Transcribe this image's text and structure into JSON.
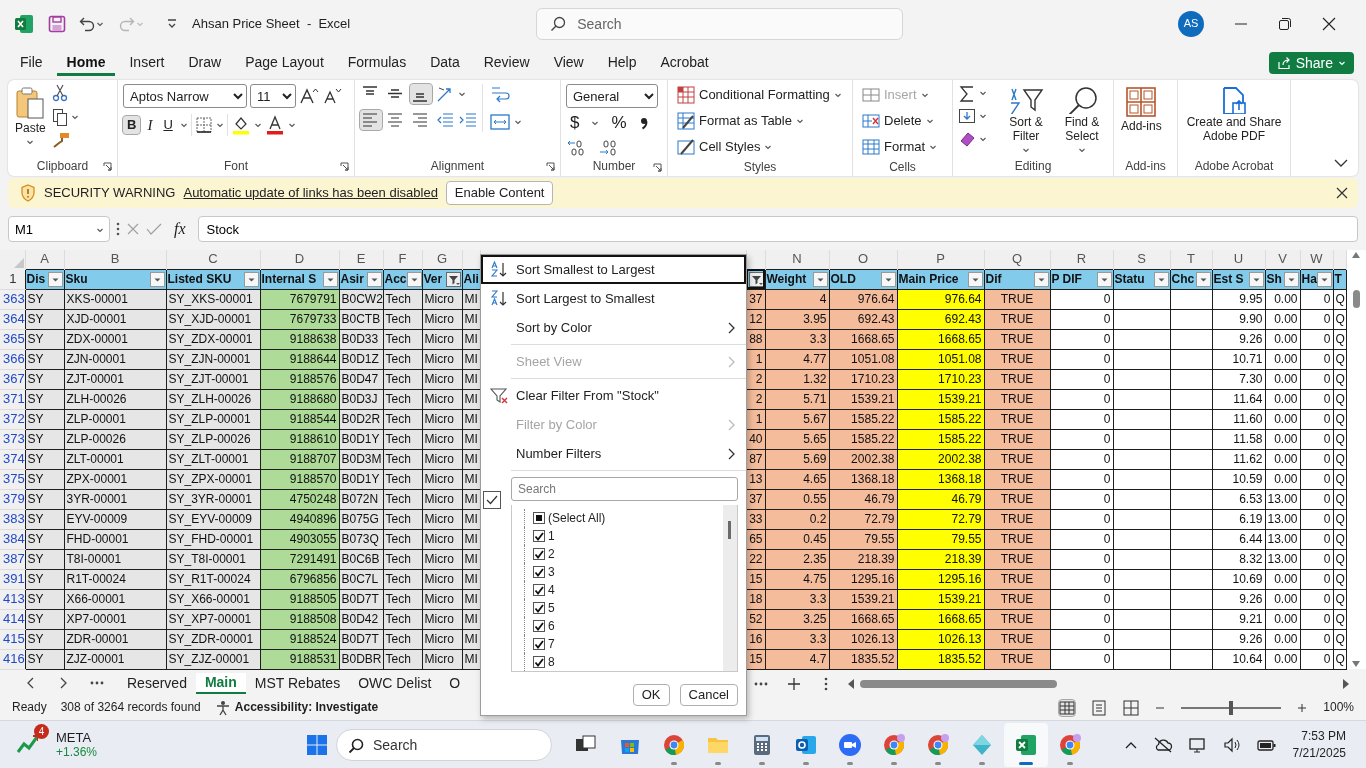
{
  "window": {
    "title": "Ahsan Price Sheet  -  Excel",
    "search_placeholder": "Search",
    "account_initials": "AS"
  },
  "menu_tabs": [
    {
      "label": "File",
      "selected": false
    },
    {
      "label": "Home",
      "selected": true
    },
    {
      "label": "Insert",
      "selected": false
    },
    {
      "label": "Draw",
      "selected": false
    },
    {
      "label": "Page Layout",
      "selected": false
    },
    {
      "label": "Formulas",
      "selected": false
    },
    {
      "label": "Data",
      "selected": false
    },
    {
      "label": "Review",
      "selected": false
    },
    {
      "label": "View",
      "selected": false
    },
    {
      "label": "Help",
      "selected": false
    },
    {
      "label": "Acrobat",
      "selected": false
    }
  ],
  "share_button": "Share",
  "ribbon": {
    "clipboard": {
      "label": "Clipboard",
      "paste": "Paste"
    },
    "font": {
      "label": "Font",
      "font_name": "Aptos Narrow",
      "font_size": "11",
      "style_buttons": [
        {
          "label": "B",
          "selected": true
        },
        {
          "label": "I",
          "selected": false
        },
        {
          "label": "U",
          "selected": false
        }
      ]
    },
    "alignment": {
      "label": "Alignment",
      "vertical": [
        {
          "selected": false
        },
        {
          "selected": false
        },
        {
          "selected": true
        }
      ],
      "horizontal": [
        {
          "selected": true
        },
        {
          "selected": false
        },
        {
          "selected": false
        }
      ]
    },
    "number": {
      "label": "Number",
      "format": "General",
      "symbols": [
        "$",
        "%"
      ]
    },
    "styles": {
      "label": "Styles",
      "commands": [
        "Conditional Formatting",
        "Format as Table",
        "Cell Styles"
      ]
    },
    "cells": {
      "label": "Cells",
      "commands": [
        {
          "label": "Insert",
          "disabled": true
        },
        {
          "label": "Delete",
          "disabled": false
        },
        {
          "label": "Format",
          "disabled": false
        }
      ]
    },
    "editing": {
      "label": "Editing",
      "commands": [
        "Sort & Filter",
        "Find & Select"
      ]
    },
    "addins": {
      "label": "Add-ins",
      "command": "Add-ins"
    },
    "acrobat": {
      "label": "Adobe Acrobat",
      "command": "Create and Share Adobe PDF"
    }
  },
  "security_bar": {
    "title": "SECURITY WARNING",
    "message": "Automatic update of links has been disabled",
    "button": "Enable Content"
  },
  "formula_bar": {
    "name_box": "M1",
    "insert_function": "fx",
    "formula": "Stock"
  },
  "sheet": {
    "header_row": "1",
    "columns": [
      {
        "letter": "A",
        "header": "Dis",
        "kind": "text",
        "color": "#e6e6e6",
        "filter_button": true,
        "filtered": false,
        "selected": false
      },
      {
        "letter": "B",
        "header": "Sku",
        "kind": "text",
        "color": "#e6e6e6",
        "filter_button": true,
        "filtered": false,
        "selected": false
      },
      {
        "letter": "C",
        "header": "Listed SKU",
        "kind": "text",
        "color": "#e6e6e6",
        "filter_button": true,
        "filtered": false,
        "selected": false
      },
      {
        "letter": "D",
        "header": "Internal S",
        "kind": "number",
        "color": "#aedc98",
        "filter_button": true,
        "filtered": false,
        "selected": false
      },
      {
        "letter": "E",
        "header": "Asir",
        "kind": "text",
        "color": "#e6e6e6",
        "filter_button": true,
        "filtered": false,
        "selected": false
      },
      {
        "letter": "F",
        "header": "Acc",
        "kind": "text",
        "color": "#e6e6e6",
        "filter_button": true,
        "filtered": false,
        "selected": false
      },
      {
        "letter": "G",
        "header": "Ver",
        "kind": "text",
        "color": "#e6e6e6",
        "filter_button": true,
        "filtered": true,
        "selected": false
      },
      {
        "header": "Ali",
        "kind": "text",
        "color": "#e6e6e6",
        "selected": false
      },
      {
        "kind": "number",
        "color": "#f5bc9c",
        "filter_button": true,
        "filtered": true,
        "selected": true
      },
      {
        "letter": "N",
        "header": "Weight",
        "kind": "number",
        "color": "#f5bc9c",
        "filter_button": true,
        "filtered": false,
        "selected": false
      },
      {
        "letter": "O",
        "header": "OLD",
        "kind": "number",
        "color": "#f5bc9c",
        "filter_button": true,
        "filtered": false,
        "selected": false
      },
      {
        "letter": "P",
        "header": "Main Price",
        "kind": "number",
        "color": "#ffff00",
        "filter_button": true,
        "filtered": false,
        "selected": false
      },
      {
        "letter": "Q",
        "header": "Dif",
        "kind": "boolean",
        "color": "#f5bc9c",
        "filter_button": true,
        "filtered": false,
        "selected": false
      },
      {
        "letter": "R",
        "header": "P DIF",
        "kind": "number",
        "color": "#ffffff",
        "filter_button": true,
        "filtered": false,
        "selected": false
      },
      {
        "letter": "S",
        "header": "Statu",
        "color": "#ffffff",
        "filter_button": true,
        "filtered": false,
        "selected": false
      },
      {
        "letter": "T",
        "header": "Chc",
        "color": "#ffffff",
        "filter_button": true,
        "filtered": false,
        "selected": false
      },
      {
        "letter": "U",
        "header": "Est S",
        "kind": "number",
        "color": "#ffffff",
        "filter_button": true,
        "filtered": false,
        "selected": false
      },
      {
        "letter": "V",
        "header": "Sh",
        "kind": "number",
        "color": "#ffffff",
        "filter_button": true,
        "filtered": false,
        "selected": false
      },
      {
        "letter": "W",
        "header": "Ha",
        "kind": "number",
        "color": "#ffffff",
        "filter_button": true,
        "filtered": false,
        "selected": false
      },
      {
        "header": "T",
        "kind": "text",
        "color": "#ffffff",
        "selected": false
      }
    ],
    "rows": [
      {
        "row": "363",
        "cells": [
          "SY",
          "XKS-00001",
          "SY_XKS-00001",
          "7679791",
          "B0CW2",
          "Tech",
          "Micro",
          "MI",
          "37",
          "4",
          "976.64",
          "976.64",
          "TRUE",
          "0",
          null,
          null,
          "9.95",
          "0.00",
          "0",
          "Q"
        ]
      },
      {
        "row": "364",
        "cells": [
          "SY",
          "XJD-00001",
          "SY_XJD-00001",
          "7679733",
          "B0CTB",
          "Tech",
          "Micro",
          "MI",
          "12",
          "3.95",
          "692.43",
          "692.43",
          "TRUE",
          "0",
          null,
          null,
          "9.90",
          "0.00",
          "0",
          "Q"
        ]
      },
      {
        "row": "365",
        "cells": [
          "SY",
          "ZDX-00001",
          "SY_ZDX-00001",
          "9188638",
          "B0D33",
          "Tech",
          "Micro",
          "MI",
          "88",
          "3.3",
          "1668.65",
          "1668.65",
          "TRUE",
          "0",
          null,
          null,
          "9.26",
          "0.00",
          "0",
          "Q"
        ]
      },
      {
        "row": "366",
        "cells": [
          "SY",
          "ZJN-00001",
          "SY_ZJN-00001",
          "9188644",
          "B0D1Z",
          "Tech",
          "Micro",
          "MI",
          "1",
          "4.77",
          "1051.08",
          "1051.08",
          "TRUE",
          "0",
          null,
          null,
          "10.71",
          "0.00",
          "0",
          "Q"
        ]
      },
      {
        "row": "367",
        "cells": [
          "SY",
          "ZJT-00001",
          "SY_ZJT-00001",
          "9188576",
          "B0D47",
          "Tech",
          "Micro",
          "MI",
          "2",
          "1.32",
          "1710.23",
          "1710.23",
          "TRUE",
          "0",
          null,
          null,
          "7.30",
          "0.00",
          "0",
          "Q"
        ]
      },
      {
        "row": "371",
        "cells": [
          "SY",
          "ZLH-00026",
          "SY_ZLH-00026",
          "9188680",
          "B0D3J",
          "Tech",
          "Micro",
          "MI",
          "2",
          "5.71",
          "1539.21",
          "1539.21",
          "TRUE",
          "0",
          null,
          null,
          "11.64",
          "0.00",
          "0",
          "Q"
        ]
      },
      {
        "row": "372",
        "cells": [
          "SY",
          "ZLP-00001",
          "SY_ZLP-00001",
          "9188544",
          "B0D2R",
          "Tech",
          "Micro",
          "MI",
          "1",
          "5.67",
          "1585.22",
          "1585.22",
          "TRUE",
          "0",
          null,
          null,
          "11.60",
          "0.00",
          "0",
          "Q"
        ]
      },
      {
        "row": "373",
        "cells": [
          "SY",
          "ZLP-00026",
          "SY_ZLP-00026",
          "9188610",
          "B0D1Y",
          "Tech",
          "Micro",
          "MI",
          "40",
          "5.65",
          "1585.22",
          "1585.22",
          "TRUE",
          "0",
          null,
          null,
          "11.58",
          "0.00",
          "0",
          "Q"
        ]
      },
      {
        "row": "374",
        "cells": [
          "SY",
          "ZLT-00001",
          "SY_ZLT-00001",
          "9188707",
          "B0D3M",
          "Tech",
          "Micro",
          "MI",
          "87",
          "5.69",
          "2002.38",
          "2002.38",
          "TRUE",
          "0",
          null,
          null,
          "11.62",
          "0.00",
          "0",
          "Q"
        ]
      },
      {
        "row": "375",
        "cells": [
          "SY",
          "ZPX-00001",
          "SY_ZPX-00001",
          "9188570",
          "B0D1Y",
          "Tech",
          "Micro",
          "MI",
          "13",
          "4.65",
          "1368.18",
          "1368.18",
          "TRUE",
          "0",
          null,
          null,
          "10.59",
          "0.00",
          "0",
          "Q"
        ]
      },
      {
        "row": "379",
        "cells": [
          "SY",
          "3YR-00001",
          "SY_3YR-00001",
          "4750248",
          "B072N",
          "Tech",
          "Micro",
          "MI",
          "37",
          "0.55",
          "46.79",
          "46.79",
          "TRUE",
          "0",
          null,
          null,
          "6.53",
          "13.00",
          "0",
          "Q"
        ]
      },
      {
        "row": "383",
        "cells": [
          "SY",
          "EYV-00009",
          "SY_EYV-00009",
          "4940896",
          "B075G",
          "Tech",
          "Micro",
          "MI",
          "33",
          "0.2",
          "72.79",
          "72.79",
          "TRUE",
          "0",
          null,
          null,
          "6.19",
          "13.00",
          "0",
          "Q"
        ]
      },
      {
        "row": "384",
        "cells": [
          "SY",
          "FHD-00001",
          "SY_FHD-00001",
          "4903055",
          "B073Q",
          "Tech",
          "Micro",
          "MI",
          "65",
          "0.45",
          "79.55",
          "79.55",
          "TRUE",
          "0",
          null,
          null,
          "6.44",
          "13.00",
          "0",
          "Q"
        ]
      },
      {
        "row": "387",
        "cells": [
          "SY",
          "T8I-00001",
          "SY_T8I-00001",
          "7291491",
          "B0C6B",
          "Tech",
          "Micro",
          "MI",
          "22",
          "2.35",
          "218.39",
          "218.39",
          "TRUE",
          "0",
          null,
          null,
          "8.32",
          "13.00",
          "0",
          "Q"
        ]
      },
      {
        "row": "391",
        "cells": [
          "SY",
          "R1T-00024",
          "SY_R1T-00024",
          "6796856",
          "B0C7L",
          "Tech",
          "Micro",
          "MI",
          "15",
          "4.75",
          "1295.16",
          "1295.16",
          "TRUE",
          "0",
          null,
          null,
          "10.69",
          "0.00",
          "0",
          "Q"
        ]
      },
      {
        "row": "413",
        "cells": [
          "SY",
          "X66-00001",
          "SY_X66-00001",
          "9188505",
          "B0D7T",
          "Tech",
          "Micro",
          "MI",
          "18",
          "3.3",
          "1539.21",
          "1539.21",
          "TRUE",
          "0",
          null,
          null,
          "9.26",
          "0.00",
          "0",
          "Q"
        ]
      },
      {
        "row": "414",
        "cells": [
          "SY",
          "XP7-00001",
          "SY_XP7-00001",
          "9188508",
          "B0D42",
          "Tech",
          "Micro",
          "MI",
          "52",
          "3.25",
          "1668.65",
          "1668.65",
          "TRUE",
          "0",
          null,
          null,
          "9.21",
          "0.00",
          "0",
          "Q"
        ]
      },
      {
        "row": "415",
        "cells": [
          "SY",
          "ZDR-00001",
          "SY_ZDR-00001",
          "9188524",
          "B0D7T",
          "Tech",
          "Micro",
          "MI",
          "16",
          "3.3",
          "1026.13",
          "1026.13",
          "TRUE",
          "0",
          null,
          null,
          "9.26",
          "0.00",
          "0",
          "Q"
        ]
      },
      {
        "row": "416",
        "cells": [
          "SY",
          "ZJZ-00001",
          "SY_ZJZ-00001",
          "9188531",
          "B0DBR",
          "Tech",
          "Micro",
          "MI",
          "15",
          "4.7",
          "1835.52",
          "1835.52",
          "TRUE",
          "0",
          null,
          null,
          "10.64",
          "0.00",
          "0",
          "Q"
        ]
      }
    ]
  },
  "filter_menu": {
    "sections": [
      [
        {
          "label": "Sort Smallest to Largest",
          "kind": "sort_ascending",
          "disabled": false,
          "submenu": false,
          "focused": true
        },
        {
          "label": "Sort Largest to Smallest",
          "kind": "sort_descending",
          "disabled": false,
          "submenu": false,
          "focused": false
        },
        {
          "label": "Sort by Color",
          "kind": "plain",
          "disabled": false,
          "submenu": true,
          "focused": false
        }
      ],
      [
        {
          "label": "Sheet View",
          "kind": "plain",
          "disabled": true,
          "submenu": true,
          "focused": false
        }
      ],
      [
        {
          "label": "Clear Filter From \"Stock\"",
          "kind": "clear_filter",
          "disabled": false,
          "submenu": false,
          "focused": false
        },
        {
          "label": "Filter by Color",
          "kind": "plain",
          "disabled": true,
          "submenu": true,
          "focused": false
        },
        {
          "label": "Number Filters",
          "kind": "plain",
          "disabled": false,
          "submenu": true,
          "focused": false
        }
      ]
    ],
    "search_placeholder": "Search",
    "side_checkbox": {
      "checked": true
    },
    "values": [
      {
        "label": "(Select All)",
        "checked": false,
        "mixed": true
      },
      {
        "label": "1",
        "checked": true,
        "mixed": false
      },
      {
        "label": "2",
        "checked": true,
        "mixed": false
      },
      {
        "label": "3",
        "checked": true,
        "mixed": false
      },
      {
        "label": "4",
        "checked": true,
        "mixed": false
      },
      {
        "label": "5",
        "checked": true,
        "mixed": false
      },
      {
        "label": "6",
        "checked": true,
        "mixed": false
      },
      {
        "label": "7",
        "checked": true,
        "mixed": false
      },
      {
        "label": "8",
        "checked": true,
        "mixed": false
      }
    ],
    "ok": "OK",
    "cancel": "Cancel"
  },
  "sheet_tabs": [
    {
      "label": "Reserved",
      "selected": false
    },
    {
      "label": "Main",
      "selected": true
    },
    {
      "label": "MST Rebates",
      "selected": false
    },
    {
      "label": "OWC Delist",
      "selected": false
    },
    {
      "label": "O",
      "selected": false
    }
  ],
  "status_bar": {
    "mode": "Ready",
    "records": "308 of 3264 records found",
    "accessibility": "Accessibility: Investigate",
    "views": [
      {
        "selected": true
      },
      {
        "selected": false
      },
      {
        "selected": false
      }
    ],
    "zoom": {
      "level": 0.5,
      "label": "100%"
    }
  },
  "taskbar": {
    "widget": {
      "title": "META",
      "change": "+1.36%",
      "badge": "4"
    },
    "search_placeholder": "Search",
    "apps": [
      {
        "kind": "taskview",
        "running": false,
        "active": false
      },
      {
        "kind": "store",
        "running": false,
        "active": false
      },
      {
        "kind": "browser",
        "running": true,
        "active": false
      },
      {
        "kind": "folder",
        "running": true,
        "active": false
      },
      {
        "kind": "calculator",
        "running": true,
        "active": false
      },
      {
        "kind": "mail",
        "running": true,
        "active": false
      },
      {
        "kind": "meeting",
        "running": true,
        "active": false
      },
      {
        "kind": "browser_profile",
        "running": true,
        "active": false
      },
      {
        "kind": "browser_profile",
        "running": true,
        "active": false
      },
      {
        "kind": "diamond",
        "running": true,
        "active": false
      },
      {
        "kind": "spreadsheet",
        "running": true,
        "active": true
      },
      {
        "kind": "browser_profile",
        "running": true,
        "active": false
      }
    ],
    "time": "7:53 PM",
    "date": "7/21/2025"
  }
}
